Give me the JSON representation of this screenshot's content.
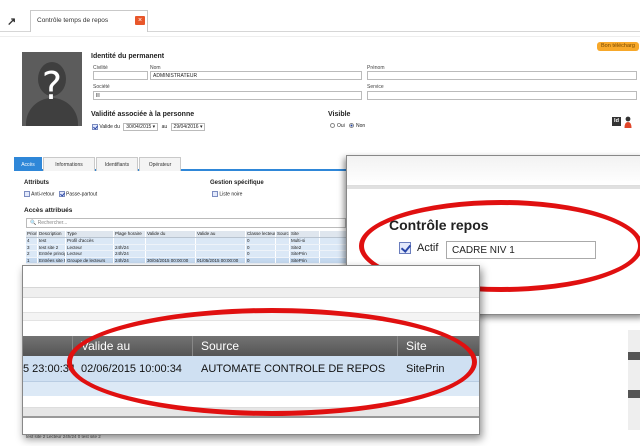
{
  "tab": {
    "icon": "↗",
    "label": "Contrôle temps de repos",
    "close": "×"
  },
  "badge": "Bon télécharg",
  "identity": {
    "title": "Identité du permanent",
    "civilite_label": "Civilité",
    "nom_label": "Nom",
    "nom_value": "ADMINISTRATEUR",
    "prenom_label": "Prénom",
    "societe_label": "Société",
    "societe_value": "Ill",
    "service_label": "Service"
  },
  "validity": {
    "title": "Validité associée à la personne",
    "valid_label": "Valide du",
    "from": "30/04/2015",
    "to_label": "au",
    "to": "29/04/2016"
  },
  "visible": {
    "title": "Visible",
    "oui": "Oui",
    "non": "Non"
  },
  "icons": {
    "id": "Id"
  },
  "tabs": [
    "Accès",
    "Informations",
    "Identifiants",
    "Opérateur"
  ],
  "attributs": {
    "title": "Attributs",
    "anti_retour": "Anti-retour",
    "passe_partout": "Passe-partout"
  },
  "gestion": {
    "title": "Gestion spécifique",
    "liste_noire": "Liste noire"
  },
  "acces": {
    "title": "Accès attribués",
    "search_placeholder": "Rechercher...",
    "columns": [
      "Priorité",
      "Description",
      "Type",
      "Plage horaire",
      "Valide du",
      "Valide au",
      "Classe lecteur",
      "Source",
      "Site"
    ],
    "rows": [
      [
        "4",
        "test",
        "Profil d'accès",
        "",
        "",
        "",
        "0",
        "",
        "Multi-si"
      ],
      [
        "3",
        "test site 2",
        "Lecteur",
        "24h/24",
        "",
        "",
        "0",
        "",
        "Site2"
      ],
      [
        "2",
        "Entrée principale",
        "Lecteur",
        "24h/24",
        "",
        "",
        "0",
        "",
        "SitePrin"
      ],
      [
        "1",
        "Entrées site Prin",
        "Groupe de lecteurs",
        "24h/24",
        "30/04/2015 00:00:00",
        "01/05/2015 00:00:00",
        "0",
        "",
        "SitePrin"
      ]
    ]
  },
  "zoom1": {
    "title": "Contrôle repos",
    "actif_label": "Actif",
    "actif_value": "CADRE NIV 1"
  },
  "zoom2": {
    "headers": [
      "Valide au",
      "Source",
      "Site"
    ],
    "row": {
      "prefix": "5 23:00:34",
      "valide_au": "02/06/2015 10:00:34",
      "source": "AUTOMATE CONTROLE DE REPOS",
      "site": "SitePrin"
    }
  },
  "bottom_row": "test site 2    Lecteur   24h/24              0                  test site 2",
  "colors": {
    "accent": "#2f87d8",
    "highlight": "#e01010",
    "badge": "#f7a82a",
    "tab_close": "#e8562a"
  }
}
